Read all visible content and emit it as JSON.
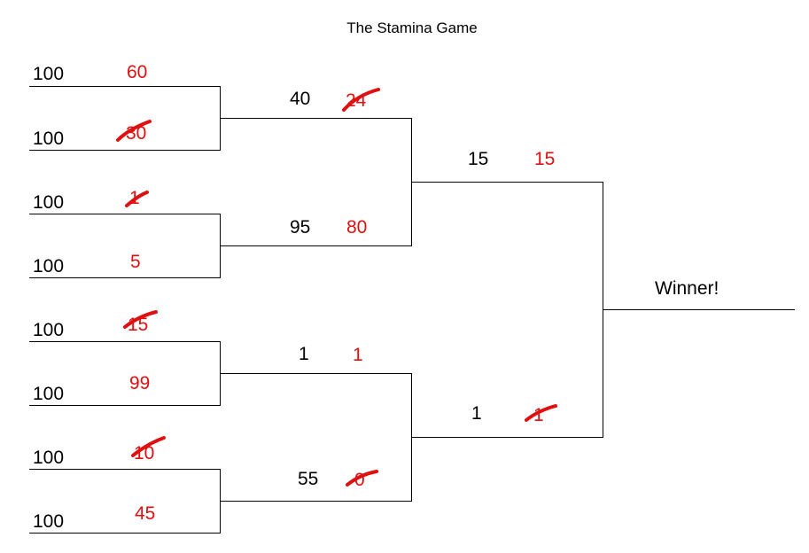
{
  "title": "The Stamina Game",
  "colors": {
    "line": "#000000",
    "text": "#000000",
    "accent": "#e01010"
  },
  "round1": [
    {
      "start": "100",
      "remaining": "60",
      "crossed": false
    },
    {
      "start": "100",
      "remaining": "30",
      "crossed": true
    },
    {
      "start": "100",
      "remaining": "1",
      "crossed": true
    },
    {
      "start": "100",
      "remaining": "5",
      "crossed": false
    },
    {
      "start": "100",
      "remaining": "15",
      "crossed": true
    },
    {
      "start": "100",
      "remaining": "99",
      "crossed": false
    },
    {
      "start": "100",
      "remaining": "10",
      "crossed": true
    },
    {
      "start": "100",
      "remaining": "45",
      "crossed": false
    }
  ],
  "round2": [
    {
      "start": "40",
      "remaining": "24",
      "crossed": true
    },
    {
      "start": "95",
      "remaining": "80",
      "crossed": false
    },
    {
      "start": "1",
      "remaining": "1",
      "crossed": false
    },
    {
      "start": "55",
      "remaining": "0",
      "crossed": true
    }
  ],
  "round3": [
    {
      "start": "15",
      "remaining": "15",
      "crossed": false
    },
    {
      "start": "1",
      "remaining": "1",
      "crossed": true
    }
  ],
  "final": {
    "label": "Winner!"
  }
}
